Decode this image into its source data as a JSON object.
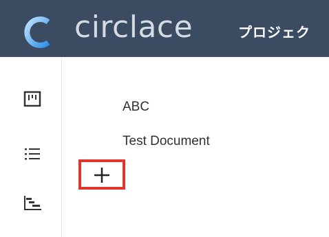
{
  "header": {
    "logo_icon": "circle-c-logo-icon",
    "app_name": "circlace",
    "nav_project": "プロジェク"
  },
  "sidebar": {
    "items": [
      {
        "icon": "kanban-board-icon"
      },
      {
        "icon": "list-icon"
      },
      {
        "icon": "gantt-chart-icon"
      }
    ]
  },
  "documents": {
    "items": [
      "ABC",
      "Test Document"
    ],
    "add_icon": "plus-icon"
  },
  "colors": {
    "header_bg": "#3b4b61",
    "highlight_border": "#e0362c"
  }
}
